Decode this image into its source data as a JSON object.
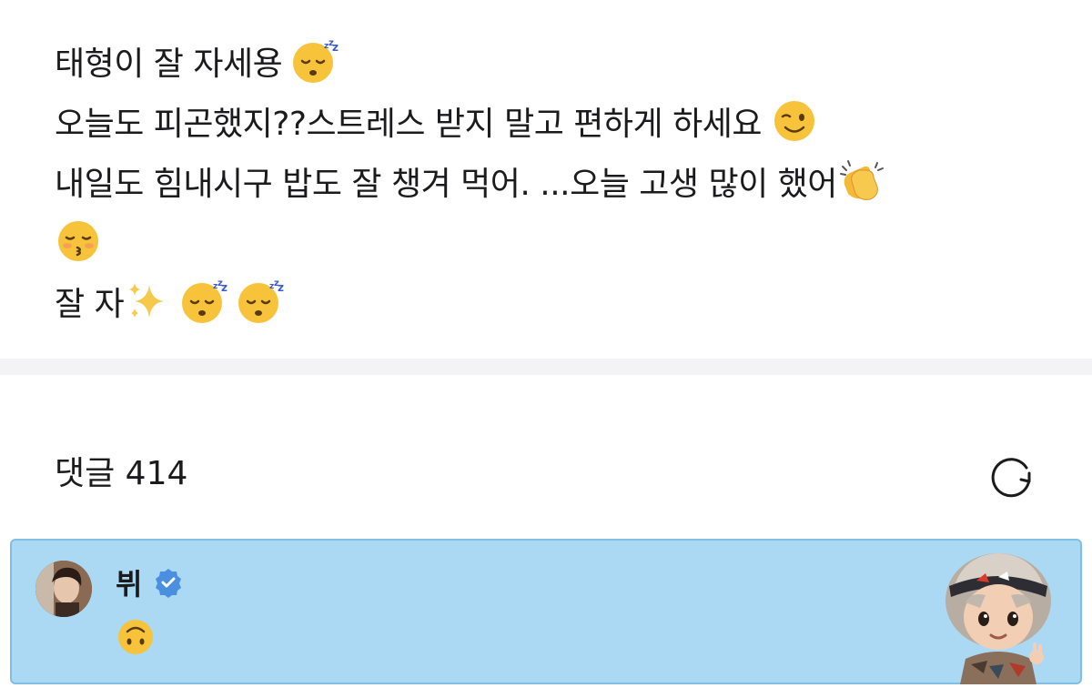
{
  "post": {
    "line1_text": "태형이 잘 자세용",
    "line2_text": "오늘도 피곤했지??스트레스 받지 말고 편하게 하세요",
    "line3_text": "내일도 힘내시구 밥도 잘 챙겨 먹어. ...오늘 고생 많이 했어",
    "line5_text": "잘 자",
    "emojis": {
      "line1": "sleeping-face-icon",
      "line2": "winking-face-icon",
      "line3": "clapping-hands-icon",
      "line4": "kissing-face-closed-eyes-icon",
      "line5": [
        "sparkles-icon",
        "sleeping-face-icon",
        "sleeping-face-icon"
      ]
    }
  },
  "comments": {
    "label": "댓글 414",
    "refresh_icon": "refresh-icon"
  },
  "highlighted_comment": {
    "author": "뷔",
    "verified_icon": "verified-badge-icon",
    "body_emoji": "upside-down-face-icon",
    "background": "#abd9f4",
    "border": "#7fbfe6",
    "sticker_icon": "character-sticker"
  },
  "colors": {
    "text": "#1b1b1d",
    "divider": "#f3f3f5",
    "verified": "#4a8fe0"
  }
}
